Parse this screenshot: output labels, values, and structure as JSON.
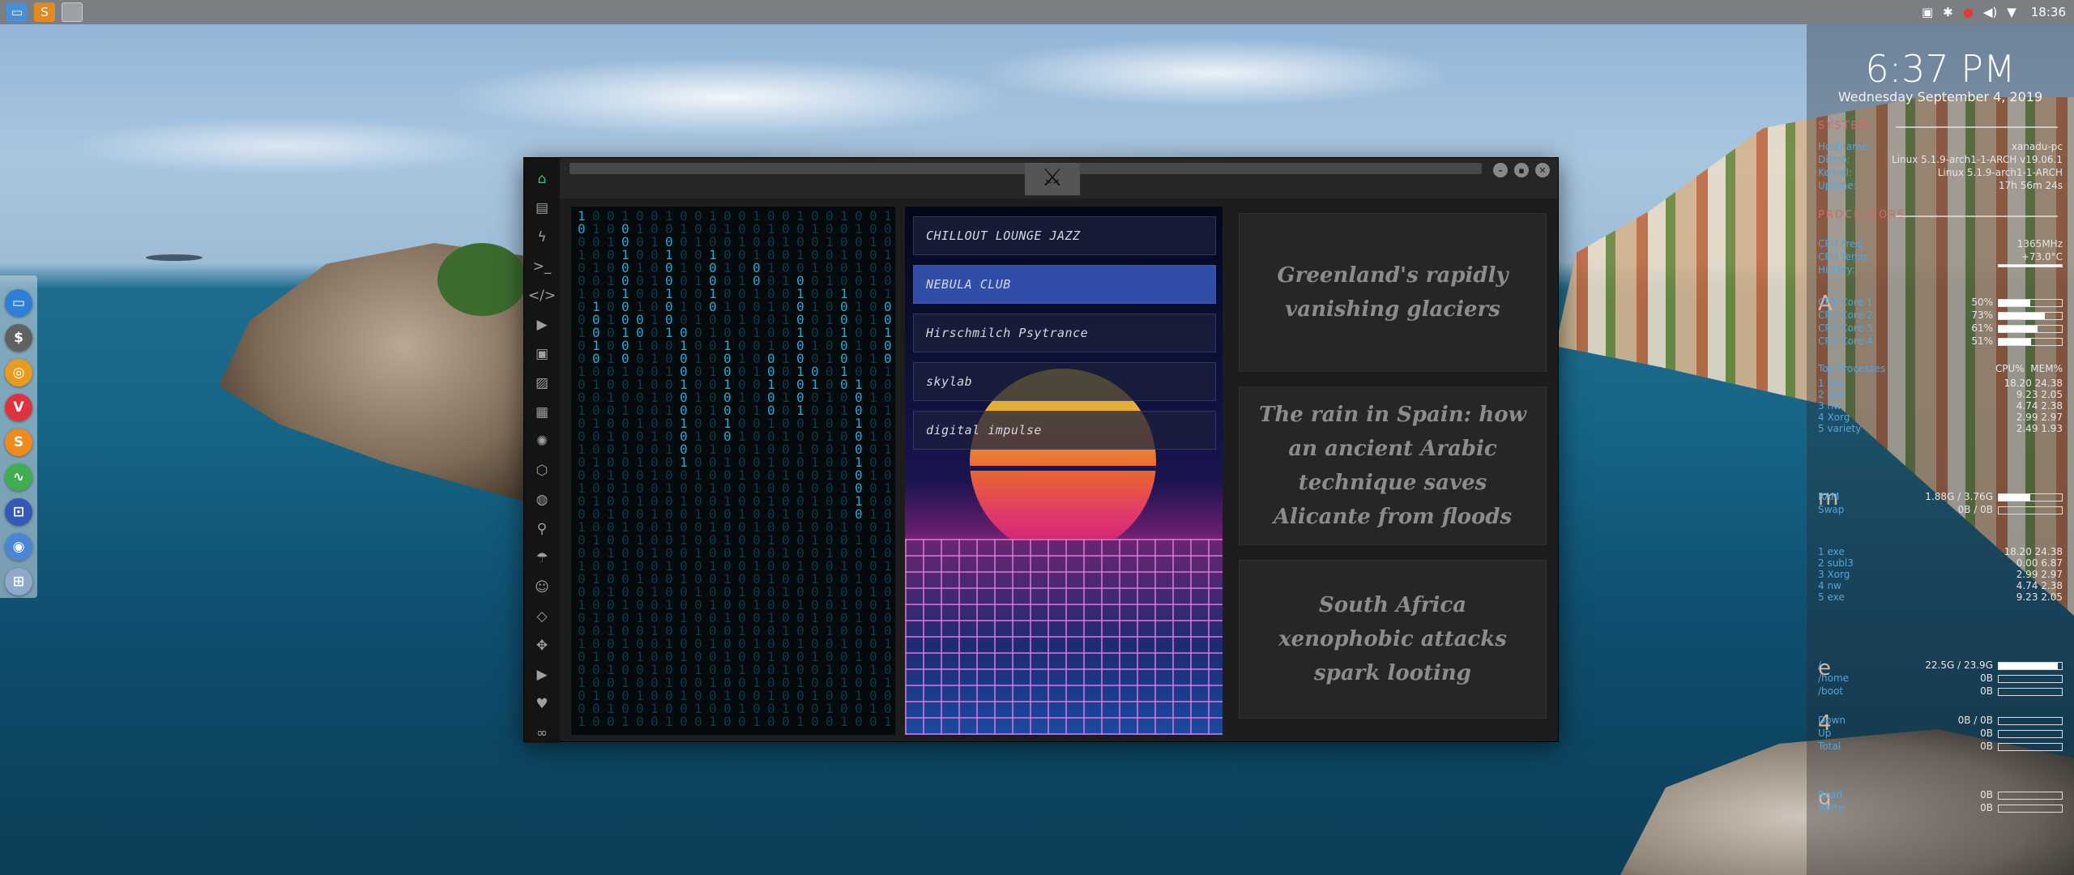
{
  "topbar": {
    "launchers": [
      "files-icon",
      "sublime-icon",
      "workspace-icon"
    ],
    "time": "18:36"
  },
  "dock": {
    "items": [
      {
        "name": "files",
        "glyph": "▭",
        "color": "#2f7fd8"
      },
      {
        "name": "money",
        "glyph": "$",
        "color": "#616161"
      },
      {
        "name": "help",
        "glyph": "◎",
        "color": "#e89b1c"
      },
      {
        "name": "vivaldi",
        "glyph": "V",
        "color": "#e0323e"
      },
      {
        "name": "sublime",
        "glyph": "S",
        "color": "#f08a1d"
      },
      {
        "name": "monitor",
        "glyph": "∿",
        "color": "#3fae4e"
      },
      {
        "name": "screenshot",
        "glyph": "⊡",
        "color": "#3359b8"
      },
      {
        "name": "chrome",
        "glyph": "◉",
        "color": "#4a86d6"
      },
      {
        "name": "network",
        "glyph": "⊞",
        "color": "#8faac9"
      }
    ]
  },
  "window": {
    "title_logo": "⚔",
    "controls": [
      "–",
      "▪",
      "✕"
    ],
    "sidebar": [
      {
        "name": "home-icon",
        "glyph": "⌂",
        "active": true
      },
      {
        "name": "document-icon",
        "glyph": "▤"
      },
      {
        "name": "flash-icon",
        "glyph": "ϟ"
      },
      {
        "name": "terminal-icon",
        "glyph": ">_"
      },
      {
        "name": "code-icon",
        "glyph": "</>"
      },
      {
        "name": "play-icon",
        "glyph": "▶"
      },
      {
        "name": "gallery-icon",
        "glyph": "▣"
      },
      {
        "name": "image-icon",
        "glyph": "▨"
      },
      {
        "name": "news-icon",
        "glyph": "▦"
      },
      {
        "name": "atom-icon",
        "glyph": "✺"
      },
      {
        "name": "hexagon-icon",
        "glyph": "⬡"
      },
      {
        "name": "globe-icon",
        "glyph": "◍"
      },
      {
        "name": "search-icon",
        "glyph": "⚲"
      },
      {
        "name": "umbrella-icon",
        "glyph": "☂"
      },
      {
        "name": "contact-icon",
        "glyph": "☺"
      },
      {
        "name": "diamond-code-icon",
        "glyph": "◇"
      },
      {
        "name": "expand-icon",
        "glyph": "✥"
      },
      {
        "name": "youtube-icon",
        "glyph": "▶"
      },
      {
        "name": "heart-icon",
        "glyph": "♥"
      },
      {
        "name": "infinity-icon",
        "glyph": "∞"
      }
    ],
    "music": {
      "tracks": [
        "CHILLOUT LOUNGE JAZZ",
        "NEBULA CLUB",
        "Hirschmilch Psytrance",
        "skylab",
        "digital impulse"
      ],
      "selected_index": 1
    },
    "news": [
      "Greenland's rapidly vanishing glaciers",
      "The rain in Spain: how an ancient Arabic technique saves Alicante from floods",
      "South Africa xenophobic attacks spark looting"
    ]
  },
  "conky": {
    "time": "6:37 PM",
    "date": "Wednesday September  4, 2019",
    "system": {
      "header": "SYSTEM",
      "rows": [
        {
          "k": "Hostname:",
          "v": "xanadu-pc"
        },
        {
          "k": "Distro:",
          "v": "Linux 5.1.9-arch1-1-ARCH v19.06.1"
        },
        {
          "k": "Kernel:",
          "v": "Linux 5.1.9-arch1-1-ARCH"
        },
        {
          "k": "Uptime:",
          "v": "17h 56m 24s"
        }
      ]
    },
    "processors": {
      "header": "PROCESSORS",
      "rows": [
        {
          "k": "CPU Freq:",
          "v": "1365MHz"
        },
        {
          "k": "CPU Temp:",
          "v": "+73.0°C"
        },
        {
          "k": "History:",
          "v": ""
        }
      ],
      "letter": "A",
      "cores": [
        {
          "k": "CPU Core 1",
          "v": "50%",
          "fill": 0.5
        },
        {
          "k": "CPU Core 2",
          "v": "73%",
          "fill": 0.73
        },
        {
          "k": "CPU Core 3",
          "v": "61%",
          "fill": 0.61
        },
        {
          "k": "CPU Core 4",
          "v": "51%",
          "fill": 0.51
        }
      ],
      "top_header": "Top Processes",
      "top_cols": [
        "CPU%",
        "MEM%"
      ],
      "top": [
        {
          "n": "1",
          "p": "exe",
          "a": "18.20",
          "b": "24.38"
        },
        {
          "n": "2",
          "p": "exe",
          "a": "9.23",
          "b": "2.05"
        },
        {
          "n": "3",
          "p": "nw",
          "a": "4.74",
          "b": "2.38"
        },
        {
          "n": "4",
          "p": "Xorg",
          "a": "2.99",
          "b": "2.97"
        },
        {
          "n": "5",
          "p": "variety",
          "a": "2.49",
          "b": "1.93"
        }
      ]
    },
    "memory": {
      "letter": "m",
      "rows": [
        {
          "k": "RAM",
          "v": "1.88G / 3.76G",
          "fill": 0.5
        },
        {
          "k": "Swap",
          "v": "0B / 0B",
          "fill": 0
        }
      ],
      "top": [
        {
          "n": "1",
          "p": "exe",
          "a": "18.20",
          "b": "24.38"
        },
        {
          "n": "2",
          "p": "subl3",
          "a": "0.00",
          "b": "6.87"
        },
        {
          "n": "3",
          "p": "Xorg",
          "a": "2.99",
          "b": "2.97"
        },
        {
          "n": "4",
          "p": "nw",
          "a": "4.74",
          "b": "2.38"
        },
        {
          "n": "5",
          "p": "exe",
          "a": "9.23",
          "b": "2.05"
        }
      ]
    },
    "disks": {
      "letter": "e",
      "rows": [
        {
          "k": "/",
          "v": "22.5G / 23.9G",
          "fill": 0.94
        },
        {
          "k": "/home",
          "v": "0B",
          "fill": 0
        },
        {
          "k": "/boot",
          "v": "0B",
          "fill": 0
        }
      ]
    },
    "network": {
      "letter": "4",
      "rows": [
        {
          "k": "Down",
          "v": "0B / 0B",
          "fill": 0
        },
        {
          "k": "Up",
          "v": "0B",
          "fill": 0
        },
        {
          "k": "Total",
          "v": "0B",
          "fill": 0
        }
      ]
    },
    "extra": {
      "letter": "q",
      "rows": [
        {
          "k": "Read",
          "v": "0B",
          "fill": 0
        },
        {
          "k": "Write",
          "v": "0B",
          "fill": 0
        }
      ]
    }
  }
}
